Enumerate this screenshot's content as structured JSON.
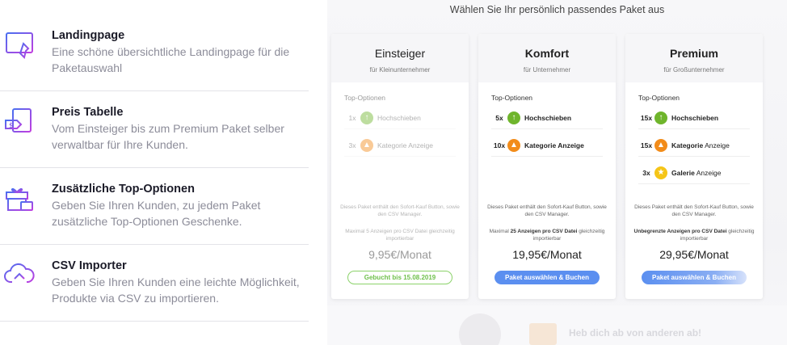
{
  "features": [
    {
      "title": "Landingpage",
      "desc": "Eine schöne übersichtliche Landingpage für die Paketauswahl",
      "icon": "landingpage-icon"
    },
    {
      "title": "Preis Tabelle",
      "desc": "Vom Einsteiger bis zum Premium Paket selber verwaltbar für Ihre Kunden.",
      "icon": "price-tag-icon"
    },
    {
      "title": "Zusätzliche Top-Optionen",
      "desc": "Geben Sie Ihren Kunden, zu jedem Paket zusätzliche Top-Optionen Geschenke.",
      "icon": "gift-icon"
    },
    {
      "title": "CSV Importer",
      "desc": "Geben Sie Ihren Kunden eine leichte Möglichkeit, Produkte via CSV zu importieren.",
      "icon": "cloud-upload-icon"
    }
  ],
  "pricing": {
    "heading": "Wählen Sie Ihr persönlich passendes Paket aus",
    "top_options_label": "Top-Optionen",
    "fine_print": "Dieses Paket enthält den Sofort-Kauf Button, sowie den CSV Manager.",
    "plans": [
      {
        "name": "Einsteiger",
        "subtitle": "für Kleinunternehmer",
        "options": [
          {
            "count": "1x",
            "label": "Hochschieben",
            "icon": "arrow-up-icon"
          },
          {
            "count": "3x",
            "label": "Kategorie Anzeige",
            "icon": "flame-icon"
          }
        ],
        "limit_pre": "Maximal 5 Anzeigen pro CSV Datei gleichzeitig importierbar",
        "price": "9,95€/Monat",
        "button": "Gebucht bis 15.08.2019"
      },
      {
        "name": "Komfort",
        "subtitle": "für Unternehmer",
        "options": [
          {
            "count": "5x",
            "label": "Hochschieben",
            "icon": "arrow-up-icon"
          },
          {
            "count": "10x",
            "label": "Kategorie Anzeige",
            "icon": "flame-icon"
          }
        ],
        "limit_pre": "Maximal ",
        "limit_bold": "25 Anzeigen pro CSV Datei",
        "limit_post": " gleichzeitig importierbar",
        "price": "19,95€/Monat",
        "button": "Paket auswählen & Buchen"
      },
      {
        "name": "Premium",
        "subtitle": "für Großunternehmer",
        "options": [
          {
            "count": "15x",
            "label": "Hochschieben",
            "icon": "arrow-up-icon"
          },
          {
            "count": "15x",
            "label_bold": "Kategorie",
            "label_norm": " Anzeige",
            "icon": "flame-icon"
          },
          {
            "count": "3x",
            "label_bold": "Galerie",
            "label_norm": " Anzeige",
            "icon": "star-icon"
          }
        ],
        "limit_bold": "Unbegrenzte Anzeigen pro CSV Datei",
        "limit_post": " gleichzeitig importierbar",
        "price": "29,95€/Monat",
        "button": "Paket auswählen & Buchen"
      }
    ]
  },
  "below": {
    "teaser": "Heb dich ab von anderen ab!"
  },
  "colors": {
    "accent_blue": "#5b8ff0",
    "green": "#6fb52c",
    "orange": "#f28c1a",
    "yellow": "#f5c518",
    "icon_purple": "#7b4fe0"
  }
}
